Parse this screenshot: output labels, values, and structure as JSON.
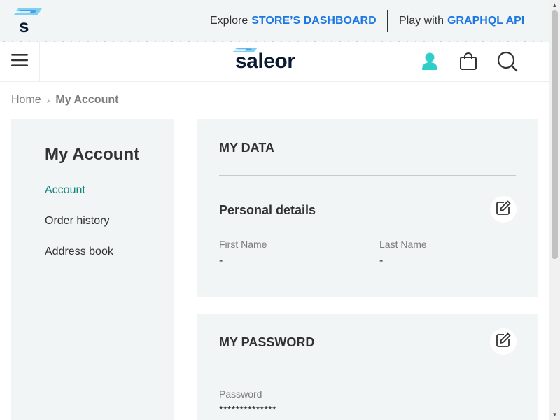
{
  "colors": {
    "accent_blue": "#1c77e3",
    "active_green": "#13867c",
    "panel_bg": "#f1f5f5",
    "user_icon": "#2ecfc9"
  },
  "topbar": {
    "logo_icon": "saleor-s-logo-icon",
    "explore_text": "Explore",
    "explore_link": "STORE’S DASHBOARD",
    "play_text": "Play with",
    "play_link": "GRAPHQL API"
  },
  "header": {
    "menu_icon": "hamburger-menu-icon",
    "logo_text": "saleor",
    "user_icon": "user-icon",
    "cart_icon": "shopping-bag-icon",
    "search_icon": "search-icon"
  },
  "breadcrumb": {
    "home": "Home",
    "separator": "›",
    "current": "My Account"
  },
  "sidebar": {
    "title": "My Account",
    "items": [
      {
        "label": "Account",
        "active": true
      },
      {
        "label": "Order history",
        "active": false
      },
      {
        "label": "Address book",
        "active": false
      }
    ]
  },
  "my_data": {
    "title": "MY DATA",
    "section_title": "Personal details",
    "edit_icon": "edit-icon",
    "fields": [
      {
        "label": "First Name",
        "value": "-"
      },
      {
        "label": "Last Name",
        "value": "-"
      }
    ]
  },
  "my_password": {
    "title": "MY PASSWORD",
    "edit_icon": "edit-icon",
    "field": {
      "label": "Password",
      "value": "**************"
    }
  }
}
